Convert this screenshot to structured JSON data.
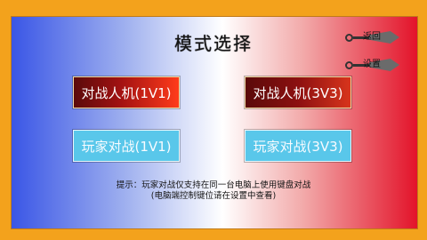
{
  "screen": {
    "title": "模式选择"
  },
  "top_menu": {
    "back_label": "返回",
    "settings_label": "设置"
  },
  "modes": {
    "ai_1v1": "对战人机(1V1)",
    "ai_3v3": "对战人机(3V3)",
    "pvp_1v1": "玩家对战(1V1)",
    "pvp_3v3": "玩家对战(3V3)"
  },
  "hint": {
    "line1": "提示：玩家对战仅支持在同一台电脑上使用键盘对战",
    "line2": "(电脑端控制键位请在设置中查看)"
  },
  "colors": {
    "frame": "#f3a21c",
    "ai_button_dark": "#5a0a0a",
    "ai_button_bright": "#ff3b1a",
    "pvp_button": "#59c7ea"
  },
  "icons": {
    "menu_marker": "kunai-icon"
  }
}
